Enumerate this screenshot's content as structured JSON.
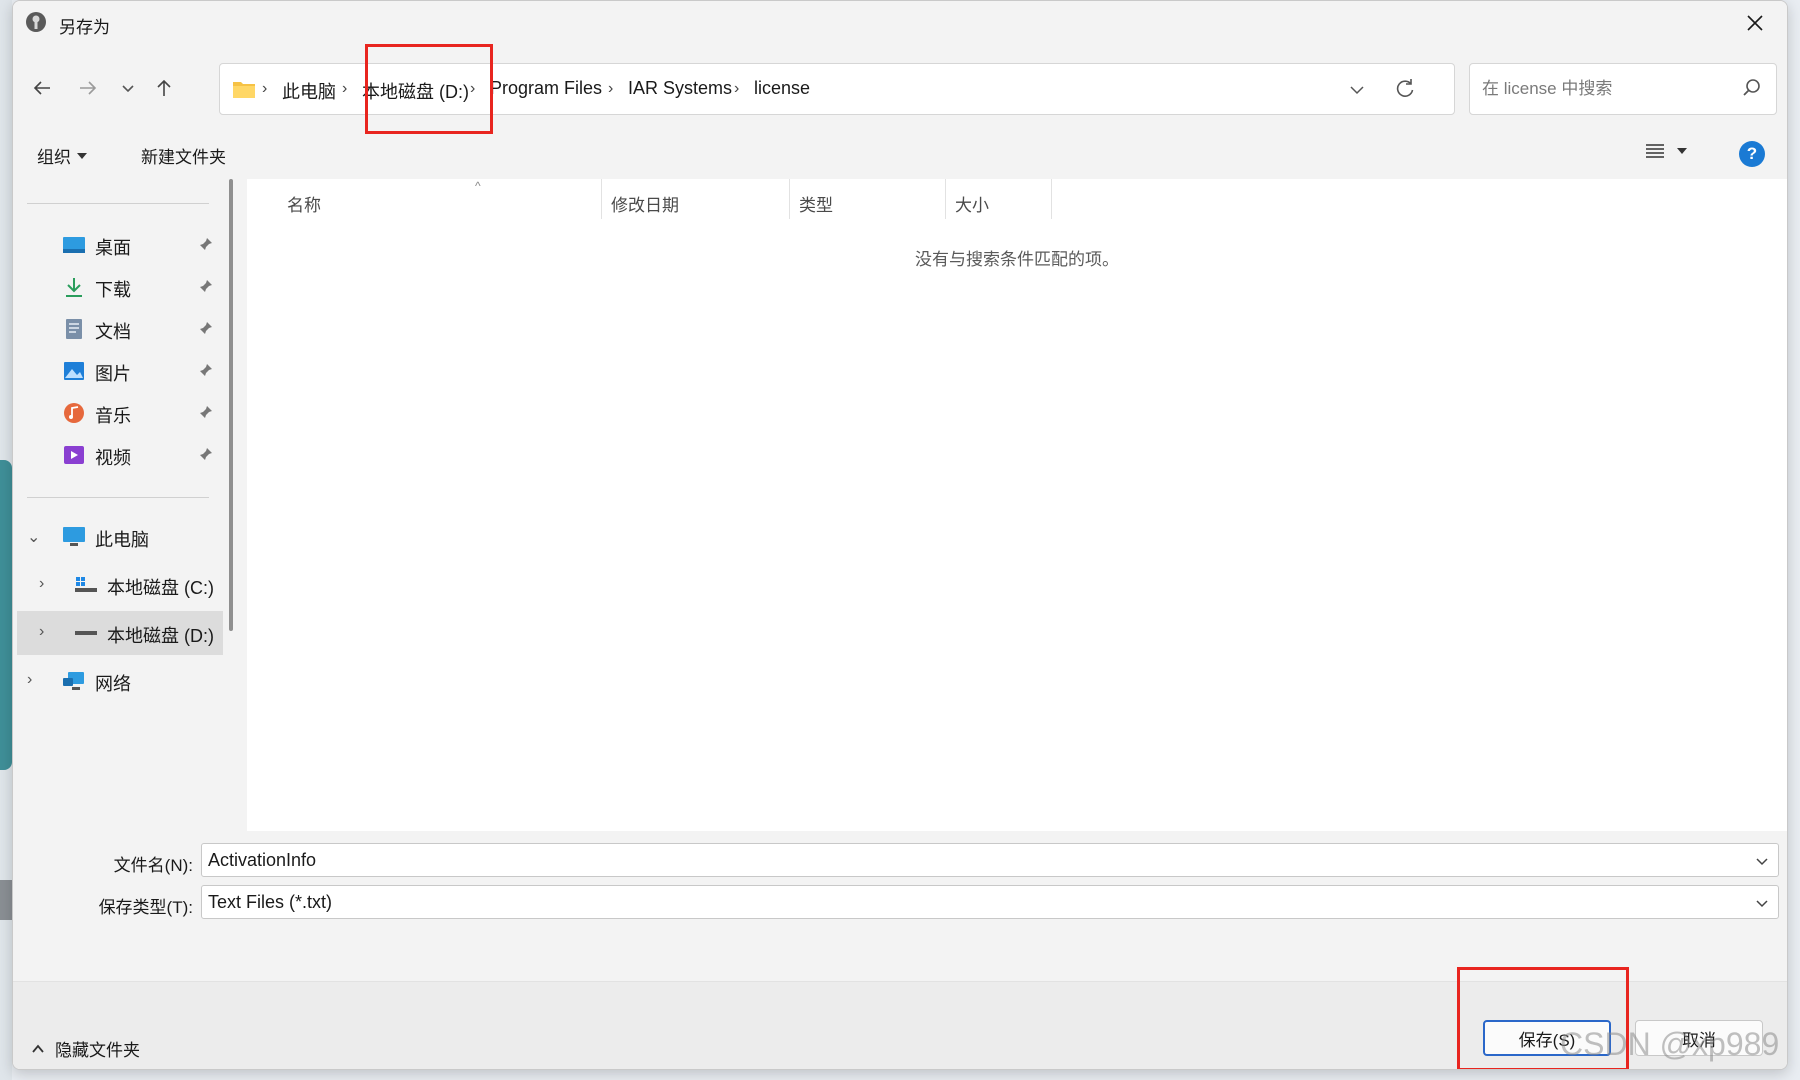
{
  "window": {
    "title": "另存为"
  },
  "nav": {
    "crumbs": [
      "此电脑",
      "本地磁盘 (D:)",
      "Program Files",
      "IAR Systems",
      "license"
    ],
    "search_placeholder": "在 license 中搜索"
  },
  "toolbar": {
    "organize_label": "组织",
    "new_folder_label": "新建文件夹"
  },
  "sidebar": {
    "quick_access": [
      {
        "label": "桌面",
        "icon": "desktop-icon"
      },
      {
        "label": "下载",
        "icon": "download-icon"
      },
      {
        "label": "文档",
        "icon": "documents-icon"
      },
      {
        "label": "图片",
        "icon": "pictures-icon"
      },
      {
        "label": "音乐",
        "icon": "music-icon"
      },
      {
        "label": "视频",
        "icon": "videos-icon"
      }
    ],
    "this_pc": "此电脑",
    "drives": [
      "本地磁盘 (C:)",
      "本地磁盘 (D:)"
    ],
    "network": "网络"
  },
  "columns": [
    "名称",
    "修改日期",
    "类型",
    "大小"
  ],
  "empty_message": "没有与搜索条件匹配的项。",
  "form": {
    "filename_label": "文件名(N):",
    "filename_value": "ActivationInfo",
    "filetype_label": "保存类型(T):",
    "filetype_value": "Text Files (*.txt)"
  },
  "footer": {
    "hide_folders_label": "隐藏文件夹",
    "save_label": "保存(S)",
    "cancel_label": "取消"
  },
  "watermark": "CSDN @xp989",
  "colors": {
    "accent": "#1a7ad4",
    "highlight": "#e8251f",
    "primary_border": "#2a67c9"
  }
}
